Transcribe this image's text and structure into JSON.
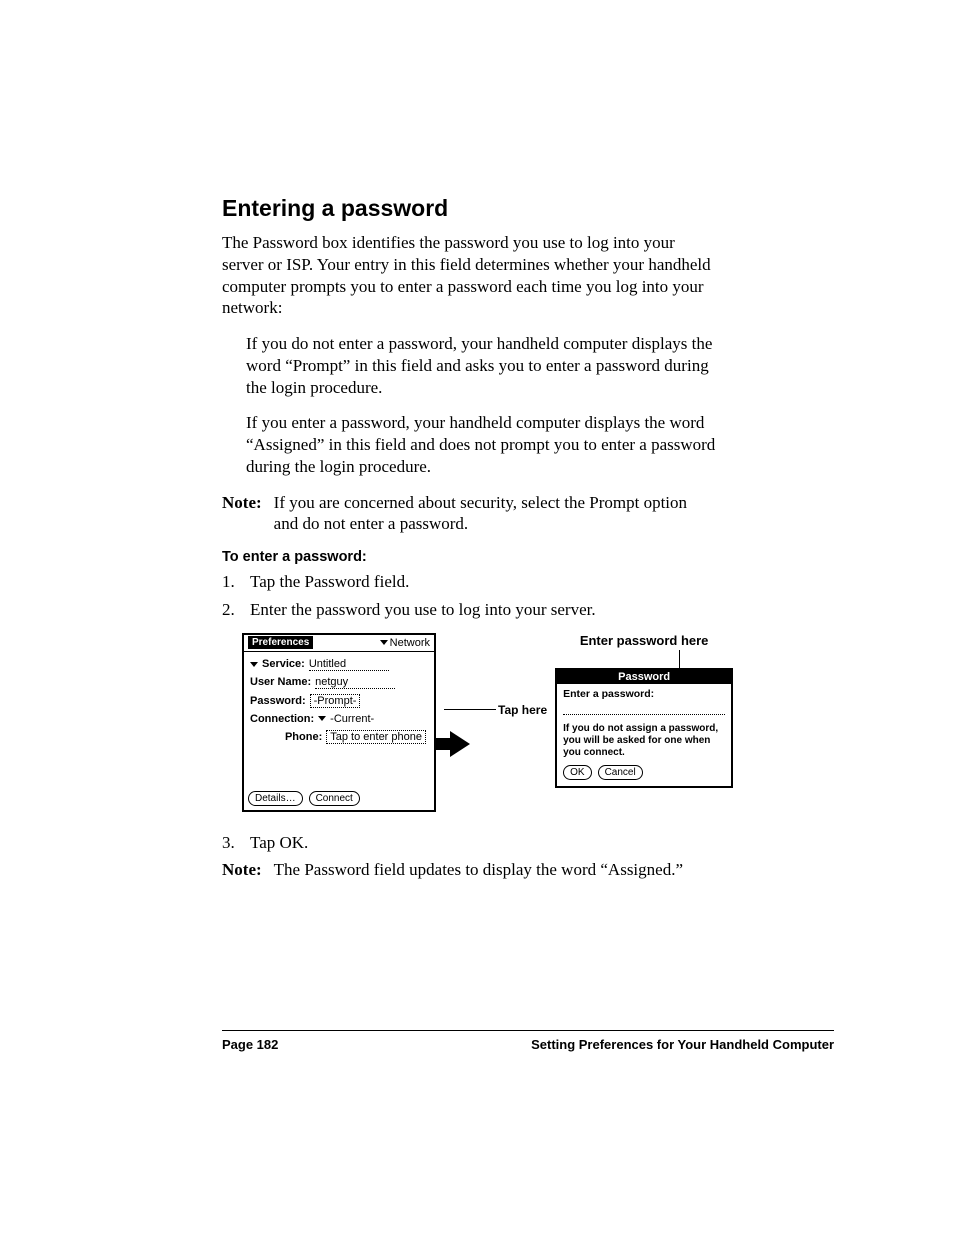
{
  "heading": "Entering a password",
  "intro": "The Password box identifies the password you use to log into your server or ISP. Your entry in this field determines whether your handheld computer prompts you to enter a password each time you log into your network:",
  "bullet1": "If you do not enter a password, your handheld computer displays the word “Prompt” in this field and asks you to enter a password during the login procedure.",
  "bullet2": "If you enter a password, your handheld computer displays the word “Assigned” in this field and does not prompt you to enter a password during the login procedure.",
  "note_label": "Note:",
  "note1_text": "If you are concerned about security, select the Prompt option and do not enter a password.",
  "subhead": "To enter a password:",
  "steps": {
    "s1_num": "1.",
    "s1_text": "Tap the Password field.",
    "s2_num": "2.",
    "s2_text": "Enter the password you use to log into your server.",
    "s3_num": "3.",
    "s3_text": "Tap OK."
  },
  "note2_text": "The Password field updates to display the word “Assigned.”",
  "figure": {
    "prefs_title": "Preferences",
    "category": "Network",
    "rows": {
      "service_label": "Service:",
      "service_value": "Untitled",
      "username_label": "User Name:",
      "username_value": "netguy",
      "password_label": "Password:",
      "password_value": "-Prompt-",
      "connection_label": "Connection:",
      "connection_value": "-Current-",
      "phone_label": "Phone:",
      "phone_value": "Tap to enter phone"
    },
    "buttons": {
      "details": "Details…",
      "connect": "Connect"
    },
    "tap_here": "Tap here",
    "dialog_caption": "Enter password here",
    "dialog": {
      "title": "Password",
      "prompt": "Enter a password:",
      "hint": "If you do not assign a password, you will be asked for one when you connect.",
      "ok": "OK",
      "cancel": "Cancel"
    }
  },
  "footer": {
    "page": "Page 182",
    "section": "Setting Preferences for Your Handheld Computer"
  }
}
